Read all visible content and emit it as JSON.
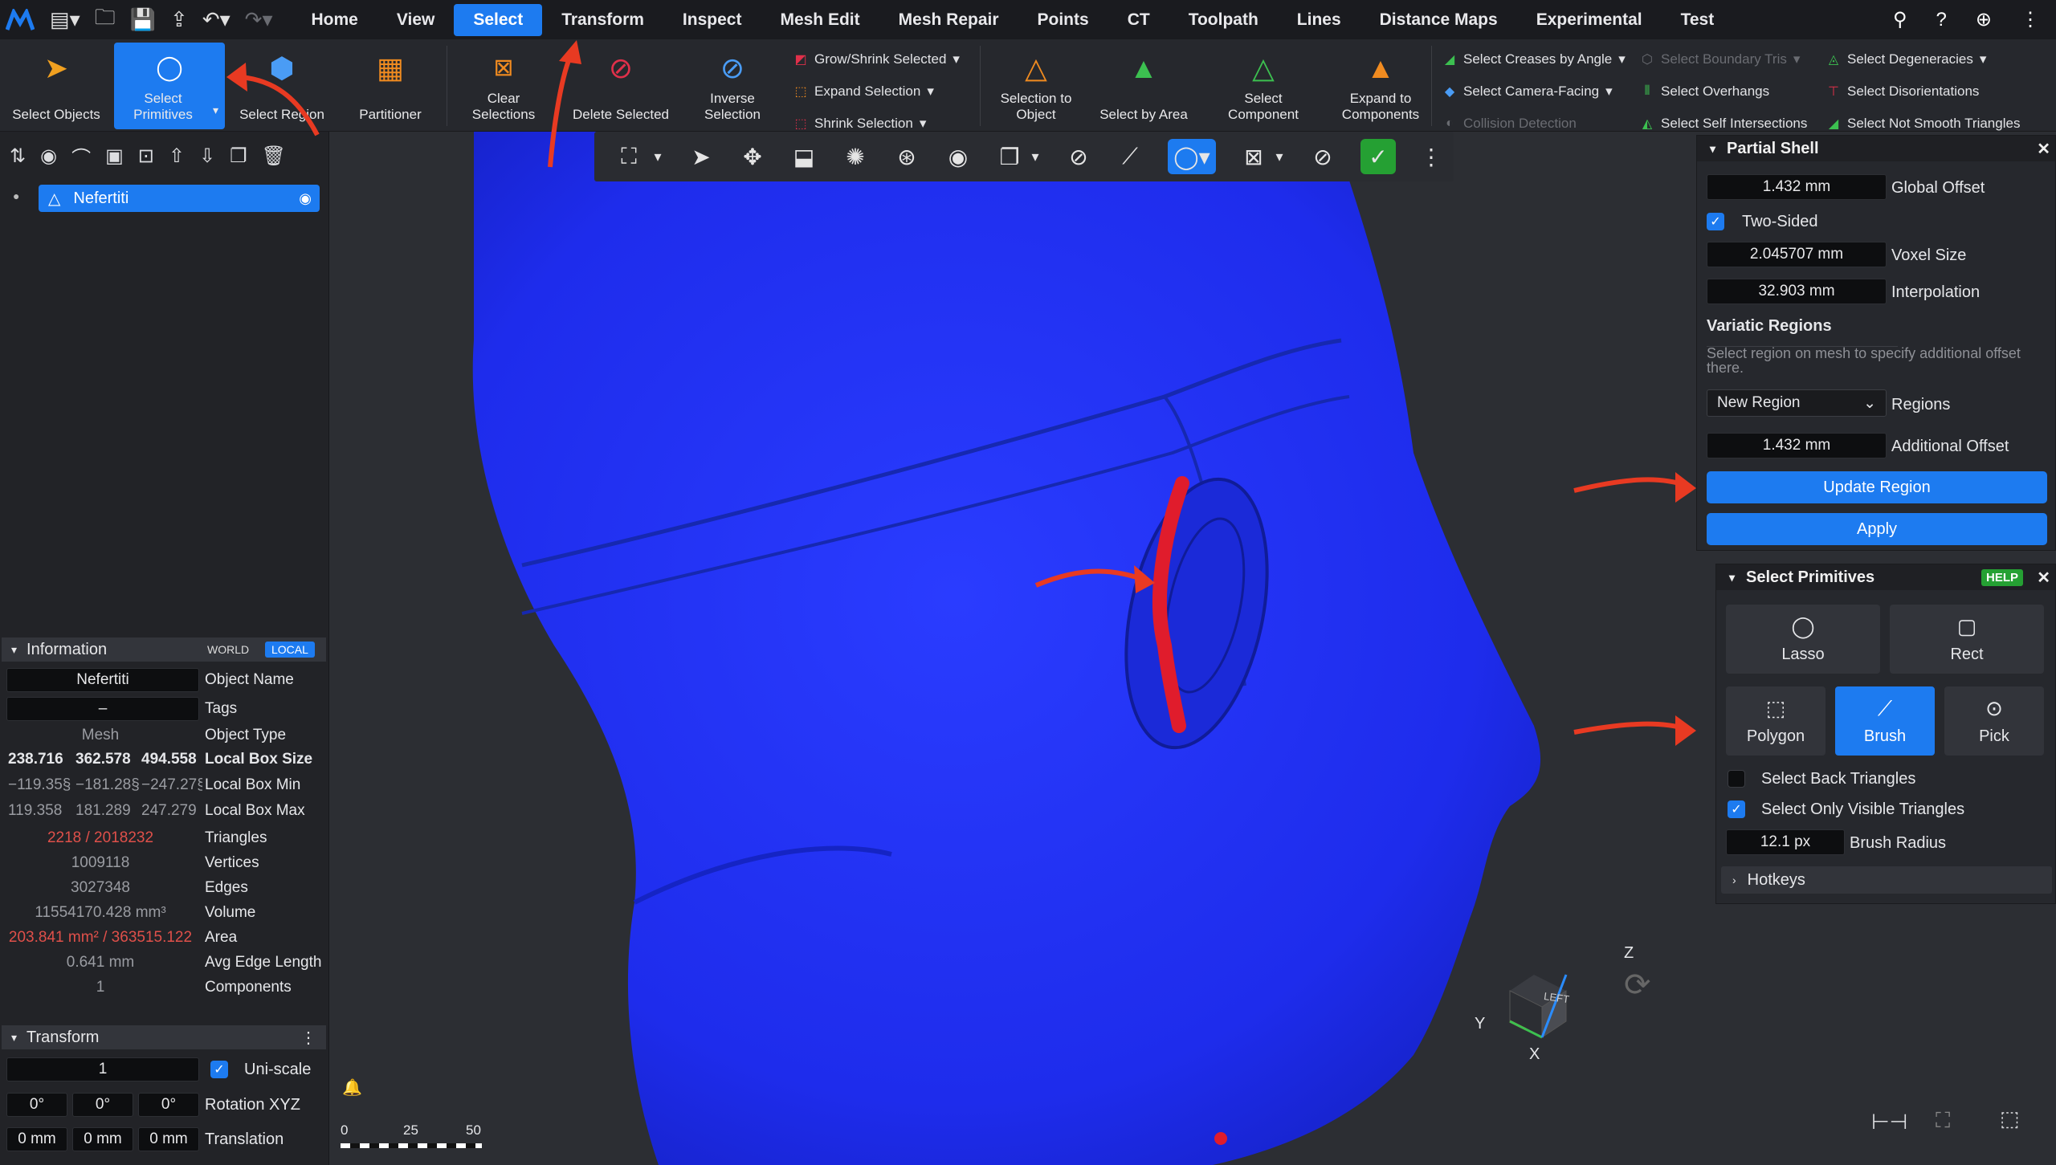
{
  "menubar": {
    "items": [
      "Home",
      "View",
      "Select",
      "Transform",
      "Inspect",
      "Mesh Edit",
      "Mesh Repair",
      "Points",
      "CT",
      "Toolpath",
      "Lines",
      "Distance Maps",
      "Experimental",
      "Test"
    ],
    "active": "Select"
  },
  "ribbon": {
    "select_objects": "Select Objects",
    "select_primitives": "Select Primitives",
    "select_region": "Select Region",
    "partitioner": "Partitioner",
    "clear_selections": "Clear Selections",
    "delete_selected": "Delete Selected",
    "inverse_selection": "Inverse Selection",
    "grow_shrink": "Grow/Shrink Selected",
    "expand_selection": "Expand Selection",
    "shrink_selection": "Shrink Selection",
    "selection_to_object": "Selection to Object",
    "select_by_area": "Select by Area",
    "select_component": "Select Component",
    "expand_to_components": "Expand to Components",
    "select_creases": "Select Creases by Angle",
    "select_camera_facing": "Select Camera-Facing",
    "collision_detection": "Collision Detection",
    "select_boundary_tris": "Select Boundary Tris",
    "select_overhangs": "Select Overhangs",
    "select_self_intersections": "Select Self Intersections",
    "select_degeneracies": "Select Degeneracies",
    "select_disorientations": "Select Disorientations",
    "select_not_smooth": "Select Not Smooth Triangles"
  },
  "tree": {
    "object": "Nefertiti"
  },
  "information": {
    "title": "Information",
    "world": "WORLD",
    "local": "LOCAL",
    "object_name": "Nefertiti",
    "object_name_label": "Object Name",
    "tags": "–",
    "tags_label": "Tags",
    "object_type": "Mesh",
    "object_type_label": "Object Type",
    "box_size": [
      "238.716",
      "362.578",
      "494.558"
    ],
    "box_size_label": "Local Box Size",
    "box_min": [
      "−119.35§",
      "−181.28§",
      "−247.27§"
    ],
    "box_min_label": "Local Box Min",
    "box_max": [
      "119.358",
      "181.289",
      "247.279"
    ],
    "box_max_label": "Local Box Max",
    "triangles": "2218 / 2018232",
    "triangles_label": "Triangles",
    "vertices": "1009118",
    "vertices_label": "Vertices",
    "edges": "3027348",
    "edges_label": "Edges",
    "volume": "11554170.428 mm³",
    "volume_label": "Volume",
    "area": "203.841 mm² / 363515.122",
    "area_label": "Area",
    "avg_edge": "0.641 mm",
    "avg_edge_label": "Avg Edge Length",
    "components": "1",
    "components_label": "Components"
  },
  "transform": {
    "title": "Transform",
    "scale": "1",
    "uniscale_label": "Uni-scale",
    "rotation": [
      "0°",
      "0°",
      "0°"
    ],
    "rotation_label": "Rotation XYZ",
    "translation": [
      "0 mm",
      "0 mm",
      "0 mm"
    ],
    "translation_label": "Translation"
  },
  "partial_shell": {
    "title": "Partial Shell",
    "global_offset": "1.432 mm",
    "global_offset_label": "Global Offset",
    "two_sided_label": "Two-Sided",
    "voxel_size": "2.045707 mm",
    "voxel_size_label": "Voxel Size",
    "interpolation": "32.903 mm",
    "interpolation_label": "Interpolation",
    "variatic_title": "Variatic Regions",
    "variatic_hint": "Select region on mesh to specify additional offset there.",
    "region_select": "New Region",
    "regions_label": "Regions",
    "additional_offset": "1.432 mm",
    "additional_offset_label": "Additional Offset",
    "update_region": "Update Region",
    "apply": "Apply"
  },
  "select_primitives": {
    "title": "Select Primitives",
    "help": "HELP",
    "tools": [
      "Lasso",
      "Rect",
      "Polygon",
      "Brush",
      "Pick"
    ],
    "active_tool": "Brush",
    "back_triangles_label": "Select Back Triangles",
    "visible_only_label": "Select Only Visible Triangles",
    "brush_radius": "12.1 px",
    "brush_radius_label": "Brush Radius",
    "hotkeys": "Hotkeys"
  },
  "scale_bar": [
    "0",
    "25",
    "50"
  ],
  "axes": {
    "z": "Z",
    "y": "Y",
    "x": "X",
    "face": "LEFT"
  },
  "colors": {
    "accent": "#1d7bf0",
    "mesh": "#1f2ff2",
    "selection": "#e01c2c",
    "annotation": "#e83a22",
    "highlight": "#e0504a"
  }
}
